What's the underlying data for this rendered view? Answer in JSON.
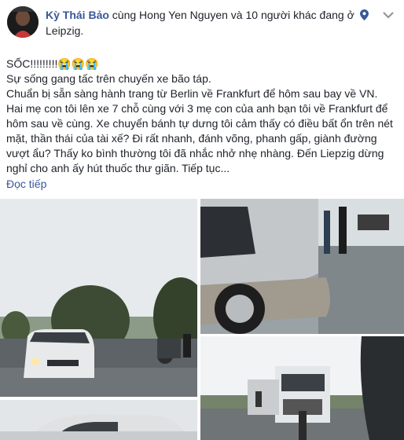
{
  "header": {
    "author": "Kỳ Thái Bảo",
    "with_text": "cùng Hong Yen Nguyen và 10 người khác đang ở",
    "location": "Leipzig."
  },
  "post": {
    "lines": [
      "SỐC!!!!!!!!!😭😭😭",
      "Sự sống gang tấc trên chuyến xe bão táp.",
      "Chuẩn bị sẵn sàng hành trang từ Berlin về Frankfurt để hôm sau bay về VN.",
      "Hai mẹ con tôi lên xe 7 chỗ cùng với 3 mẹ con của anh bạn tôi về Frankfurt để hôm sau về cùng. Xe chuyển bánh tự dưng tôi cảm thấy có điều bất ổn trên nét mặt, thần thái của tài xế? Đi rất nhanh, đánh võng, phanh gấp, giành đường vượt ẩu? Thấy ko bình thường tôi đã nhắc nhở nhẹ nhàng. Đến Liepzig dừng nghỉ cho anh ấy hút thuốc thư giãn. Tiếp tục..."
    ],
    "see_more": "Đọc tiếp"
  },
  "icons": {
    "location": "location-pin-icon",
    "menu": "chevron-down-icon"
  },
  "colors": {
    "link": "#385898",
    "text": "#1d2129"
  }
}
